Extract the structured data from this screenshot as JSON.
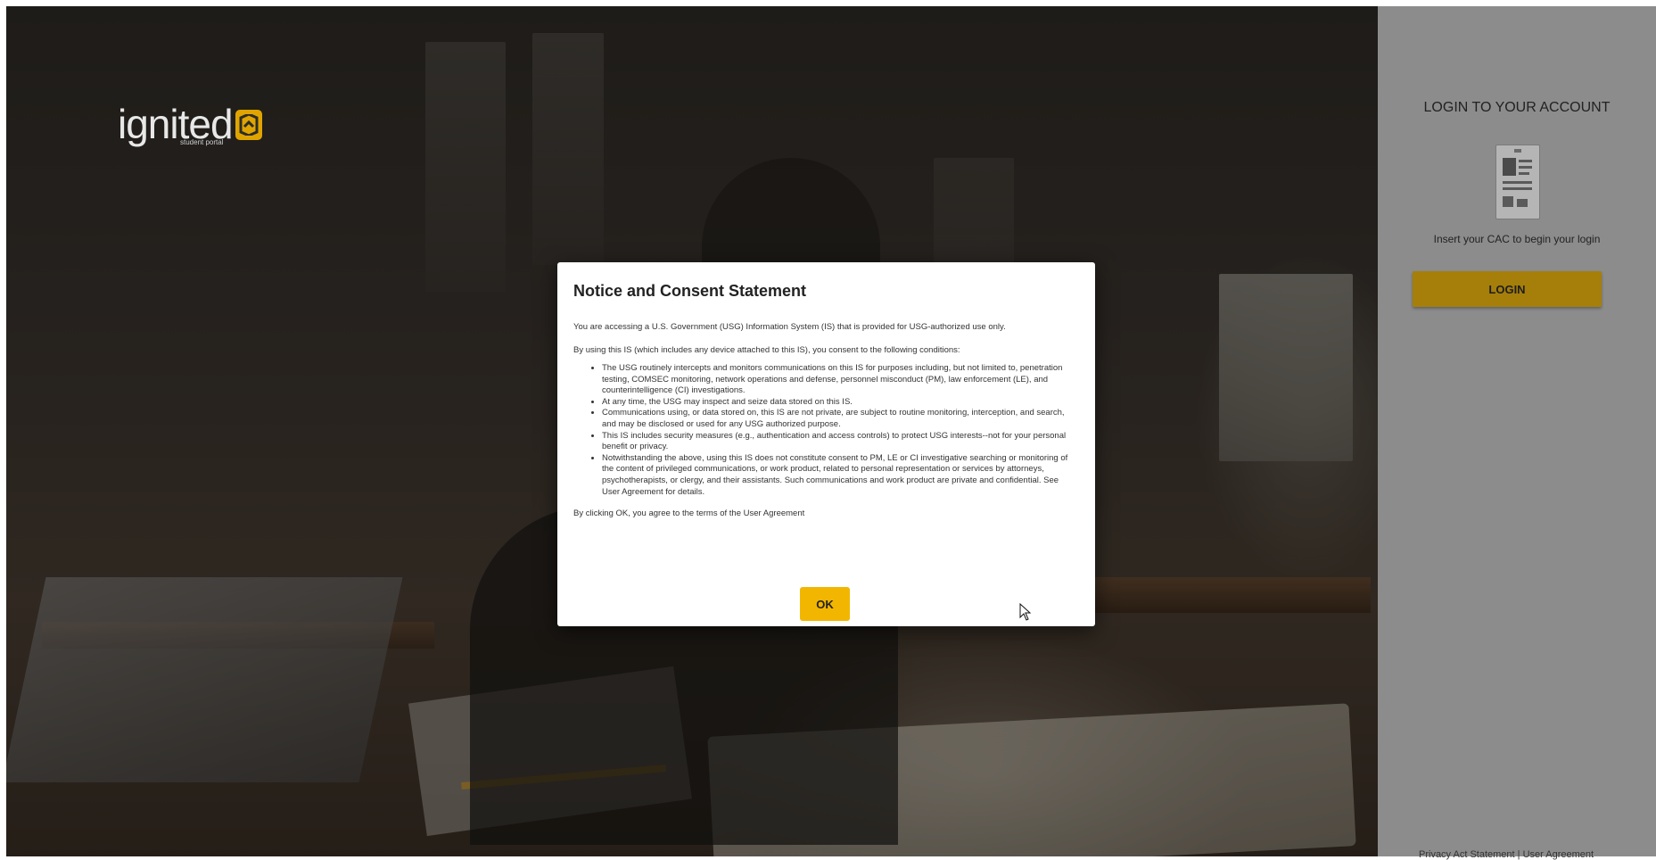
{
  "brand": {
    "name": "ignited",
    "tagline": "student portal",
    "accent": "#f2b600"
  },
  "login_panel": {
    "title": "LOGIN TO YOUR ACCOUNT",
    "cac_icon": "cac-card-icon",
    "hint": "Insert your CAC to begin your login",
    "login_label": "LOGIN",
    "footer": {
      "privacy": "Privacy Act Statement",
      "separator": "|",
      "agreement": "User Agreement"
    }
  },
  "dialog": {
    "title": "Notice and Consent Statement",
    "intro1": "You are accessing a U.S. Government (USG) Information System (IS) that is provided for USG-authorized use only.",
    "intro2": "By using this IS (which includes any device attached to this IS), you consent to the following conditions:",
    "items": [
      "The USG routinely intercepts and monitors communications on this IS for purposes including, but not limited to, penetration testing, COMSEC monitoring, network operations and defense, personnel misconduct (PM), law enforcement (LE), and counterintelligence (CI) investigations.",
      "At any time, the USG may inspect and seize data stored on this IS.",
      "Communications using, or data stored on, this IS are not private, are subject to routine monitoring, interception, and search, and may be disclosed or used for any USG authorized purpose.",
      "This IS includes security measures (e.g., authentication and access controls) to protect USG interests--not for your personal benefit or privacy.",
      "Notwithstanding the above, using this IS does not constitute consent to PM, LE or CI investigative searching or monitoring of the content of privileged communications, or work product, related to personal representation or services by attorneys, psychotherapists, or clergy, and their assistants. Such communications and work product are private and confidential. See User Agreement for details."
    ],
    "closing": "By clicking OK, you agree to the terms of the User Agreement",
    "ok_label": "OK"
  }
}
